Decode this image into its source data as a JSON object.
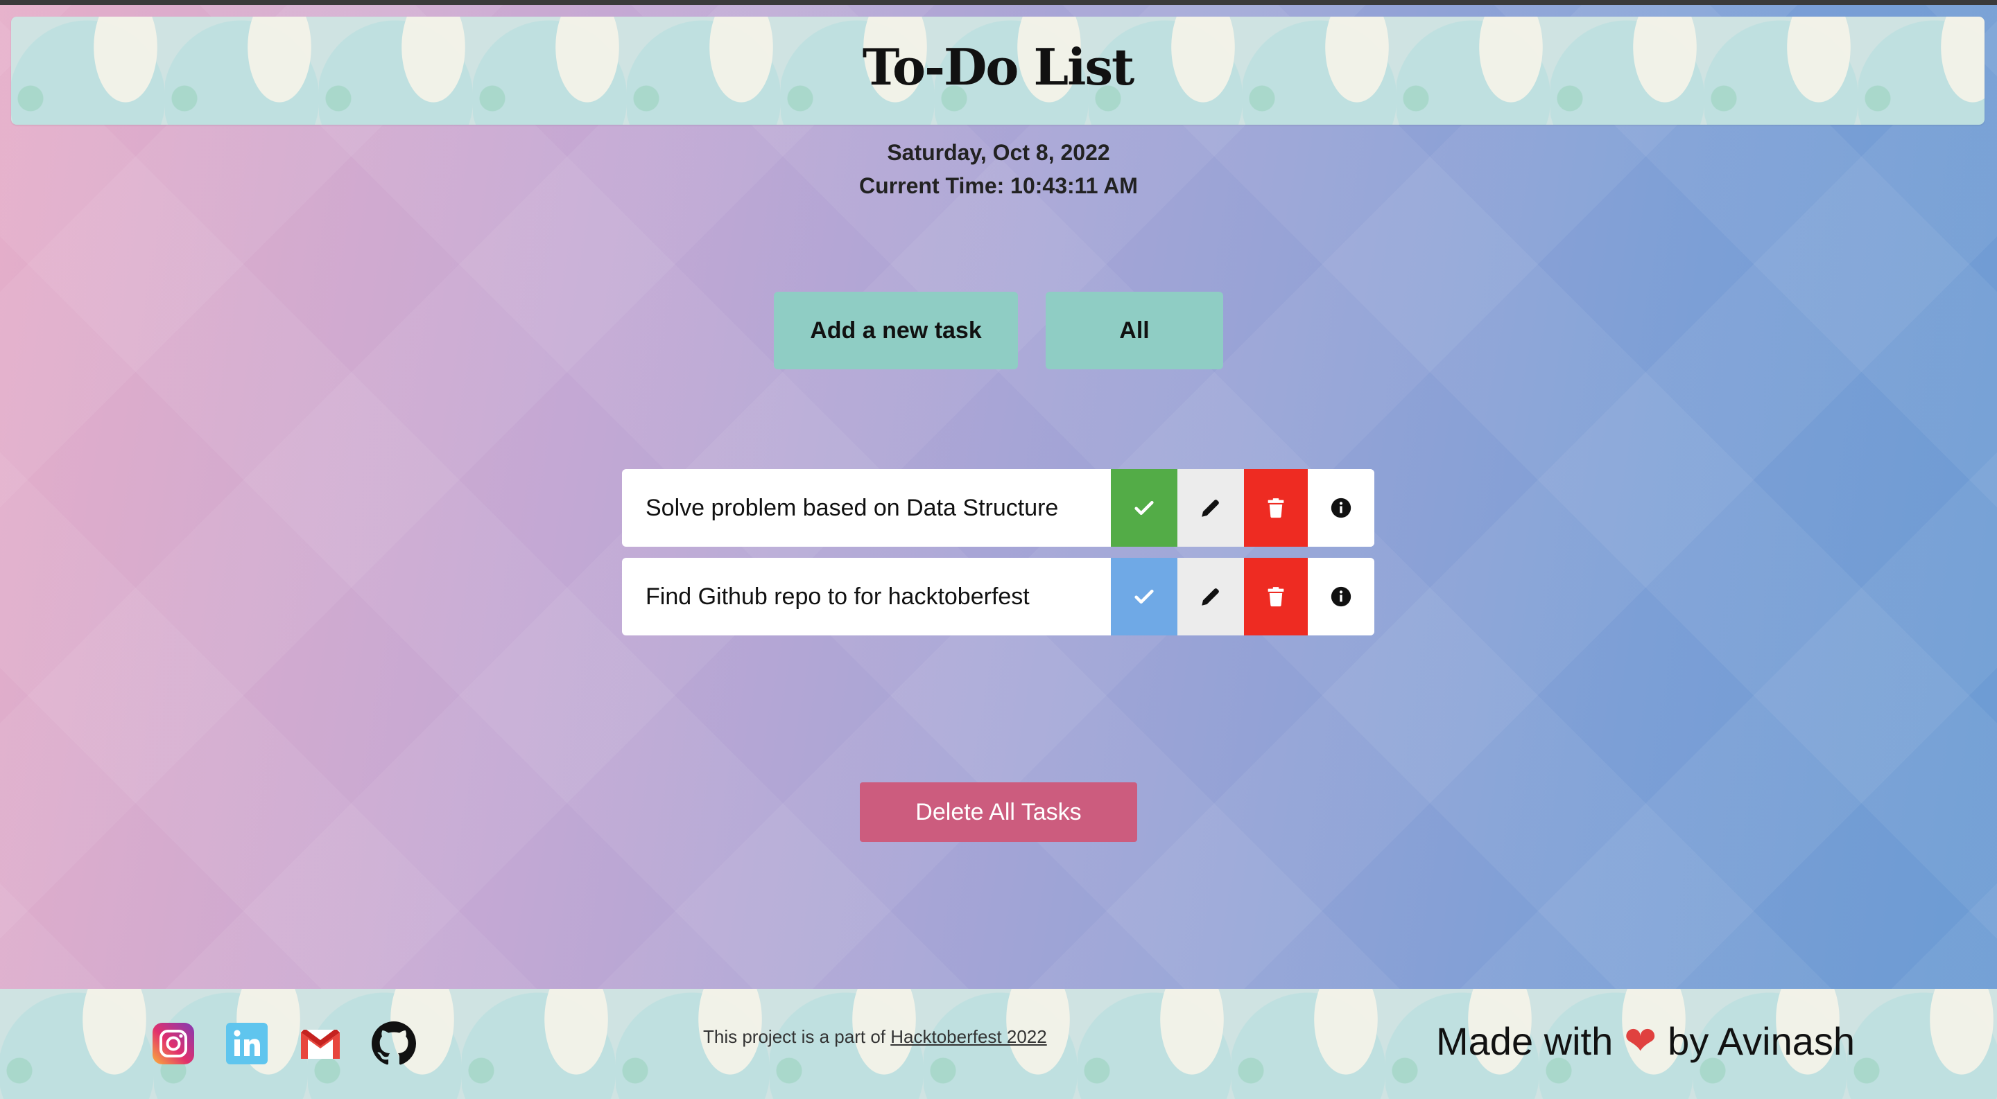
{
  "header": {
    "title": "To-Do List"
  },
  "datetime": {
    "date": "Saturday, Oct 8, 2022",
    "time": "Current Time: 10:43:11 AM"
  },
  "controls": {
    "add_label": "Add a new task",
    "filter_label": "All"
  },
  "tasks": [
    {
      "text": "Solve problem based on Data Structure",
      "status": "completed",
      "status_color": "#53ac47"
    },
    {
      "text": "Find Github repo to for hacktoberfest",
      "status": "pending",
      "status_color": "#6fa9e6"
    }
  ],
  "actions": {
    "delete_all_label": "Delete All Tasks"
  },
  "footer": {
    "social": [
      {
        "name": "instagram-icon"
      },
      {
        "name": "linkedin-icon"
      },
      {
        "name": "gmail-icon"
      },
      {
        "name": "github-icon"
      }
    ],
    "note_prefix": "This project is a part of",
    "note_link": "Hacktoberfest 2022",
    "made_prefix": "Made with",
    "made_suffix": "by Avinash"
  },
  "colors": {
    "accent": "#8fcdc4",
    "delete": "#ee2b22",
    "delete_all": "#cc5c7e"
  }
}
